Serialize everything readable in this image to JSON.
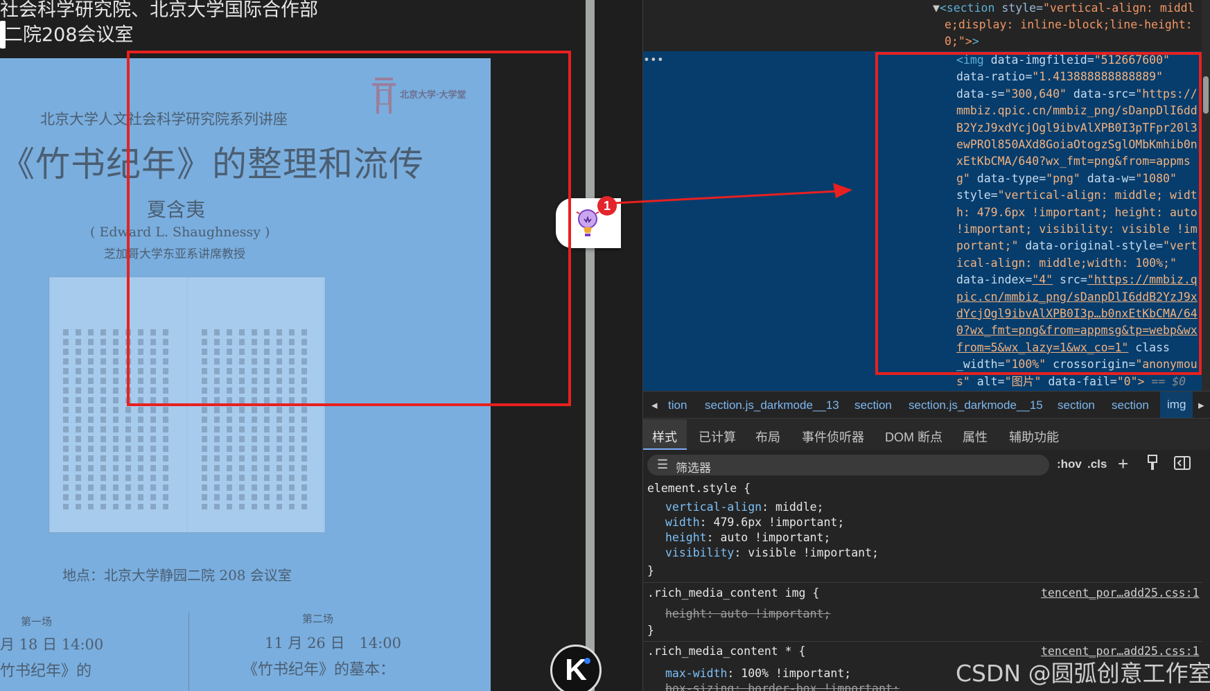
{
  "left_page": {
    "heading_line1": "社会科学研究院、北京大学国际合作部",
    "heading_line2": "二院208会议室"
  },
  "poster": {
    "logo_text": "北京大学·大学堂",
    "series": "北京大学人文社会科学研究院系列讲座",
    "title": "《竹书纪年》的整理和流传",
    "speaker": "夏含夷",
    "speaker_en": "( Edward L. Shaughnessy )",
    "speaker_title": "芝加哥大学东亚系讲席教授",
    "venue": "地点：北京大学静园二院 208 会议室",
    "session1_label": "第一场",
    "session1_time": "月 18 日 14:00",
    "session1_topic": "竹书纪年》的",
    "session2_label": "第二场",
    "session2_time": "11 月 26 日　14:00",
    "session2_topic": "《竹书纪年》的墓本："
  },
  "extension": {
    "badge_count": "1",
    "icon": "lightbulb-icon"
  },
  "k_button": {
    "label": "K"
  },
  "devtools": {
    "dom_lines": {
      "l1": [
        "section",
        "style",
        "\"vertical-align: middl"
      ],
      "l2": "e;display: inline-block;line-height: ",
      "l3": "0;\">",
      "img": [
        [
          "<img ",
          "data-imgfileid",
          "=",
          "\"512667600\""
        ],
        [
          "data-ratio",
          "=",
          "\"1.413888888888889\""
        ],
        [
          "data-s",
          "=",
          "\"300,640\"",
          " data-src",
          "=",
          "\"https://"
        ],
        [
          "mmbiz.qpic.cn/mmbiz_png/sDanpDlI6dd"
        ],
        [
          "B2YzJ9xdYcjOgl9ibvAlXPB0I3pTFpr20l3"
        ],
        [
          "ewPROl850AXd8GoiaOtogzSglOMbKmhib0n"
        ],
        [
          "xEtKbCMA/640?wx_fmt=png&from=appms"
        ],
        [
          "g\"",
          " data-type",
          "=",
          "\"png\"",
          " data-w",
          "=",
          "\"1080\""
        ],
        [
          "style",
          "=",
          "\"vertical-align: middle; widt"
        ],
        [
          "h: 479.6px !important; height: auto"
        ],
        [
          "!important; visibility: visible !im"
        ],
        [
          "portant;\"",
          " data-original-style",
          "=",
          "\"vert"
        ],
        [
          "ical-align: middle;width: 100%;\""
        ],
        [
          "data-index",
          "=",
          "\"4\"",
          " src",
          "=",
          "\"https://mmbiz.q"
        ],
        [
          "pic.cn/mmbiz_png/sDanpDlI6ddB2YzJ9x"
        ],
        [
          "dYcjOgl9ibvAlXPB0I3p…b0nxEtKbCMA/64"
        ],
        [
          "0?wx_fmt=png&from=appmsg&tp=webp&wx"
        ],
        [
          "from=5&wx_lazy=1&wx_co=1\"",
          " class"
        ],
        [
          "_width",
          "=",
          "\"100%\"",
          " crossorigin",
          "=",
          "\"anonymou"
        ],
        [
          "s\"",
          " alt",
          "=",
          "\"图片\"",
          " data-fail",
          "=",
          "\"0\">",
          " == $0"
        ]
      ],
      "ellipsis": "•••"
    },
    "breadcrumbs": [
      "tion",
      "section.js_darkmode__13",
      "section",
      "section.js_darkmode__15",
      "section",
      "section",
      "img"
    ],
    "tabs": [
      "样式",
      "已计算",
      "布局",
      "事件侦听器",
      "DOM 断点",
      "属性",
      "辅助功能"
    ],
    "filter_placeholder": "筛选器",
    "filter_tools": [
      ":hov",
      ".cls",
      "+"
    ],
    "rules": {
      "r1_selector": "element.style {",
      "r1_props": [
        [
          "vertical-align",
          "middle;"
        ],
        [
          "width",
          "479.6px !important;"
        ],
        [
          "height",
          "auto !important;"
        ],
        [
          "visibility",
          "visible !important;"
        ]
      ],
      "close": "}",
      "r2_selector": ".rich_media_content img {",
      "r2_source": "tencent_por…add25.css:1",
      "r2_prop": "height: auto !important;",
      "r3_selector": ".rich_media_content * {",
      "r3_source": "tencent_por…add25.css:1",
      "r3_prop1": [
        "max-width",
        "100% !important;"
      ],
      "r3_prop2": "box-sizing: border-box !important;"
    }
  },
  "watermark": "CSDN @圆弧创意工作室",
  "colors": {
    "annotation_red": "#e8201f",
    "poster_blue": "#7aaede",
    "selection_blue": "#063d6d"
  }
}
